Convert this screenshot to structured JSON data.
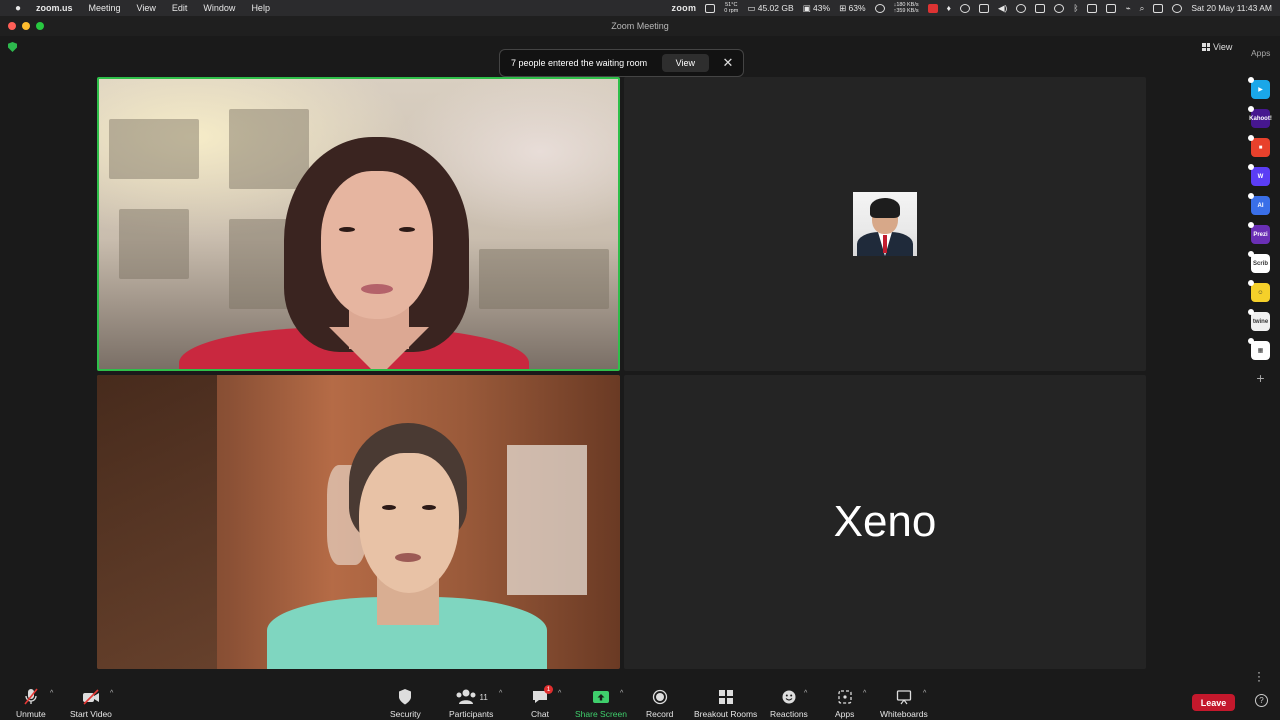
{
  "menubar": {
    "app_name": "zoom.us",
    "menus": [
      "Meeting",
      "View",
      "Edit",
      "Window",
      "Help"
    ],
    "zoom_brand": "zoom",
    "temp": "51°C",
    "fan": "0 rpm",
    "disk": "45.02 GB",
    "cpu": "43%",
    "mem": "63%",
    "net_down": "↓180 KB/s",
    "net_up": "↑359 KB/s",
    "datetime": "Sat 20 May  11:43 AM"
  },
  "window": {
    "title": "Zoom Meeting"
  },
  "notification": {
    "message": "7 people entered the waiting room",
    "view_label": "View",
    "close_glyph": "✕"
  },
  "view_menu": {
    "label": "View"
  },
  "apps_rail": {
    "label": "Apps",
    "apps": [
      {
        "name": "app-1",
        "color": "#1aa7e8",
        "glyph": "▶"
      },
      {
        "name": "app-kahoot",
        "color": "#46178f",
        "glyph": "Kahoot!"
      },
      {
        "name": "app-3",
        "color": "#e8412c",
        "glyph": "■"
      },
      {
        "name": "app-w",
        "color": "#5b3df5",
        "glyph": "W"
      },
      {
        "name": "app-ai",
        "color": "#3a6fe8",
        "glyph": "AI"
      },
      {
        "name": "app-prezi",
        "color": "#6a2fb5",
        "glyph": "Prezi"
      },
      {
        "name": "app-scribble",
        "color": "#ffffff",
        "glyph": "Scrib"
      },
      {
        "name": "app-emoji",
        "color": "#f5d02a",
        "glyph": "☺"
      },
      {
        "name": "app-twine",
        "color": "#f0f0f0",
        "glyph": "twine"
      },
      {
        "name": "app-grid",
        "color": "#ffffff",
        "glyph": "▦"
      }
    ],
    "add_glyph": "+"
  },
  "participants": {
    "tile4_name": "Xeno"
  },
  "toolbar": {
    "unmute": "Unmute",
    "start_video": "Start Video",
    "security": "Security",
    "participants": "Participants",
    "participant_count": "11",
    "chat": "Chat",
    "chat_badge": "1",
    "share_screen": "Share Screen",
    "record": "Record",
    "breakout_rooms": "Breakout Rooms",
    "reactions": "Reactions",
    "apps": "Apps",
    "whiteboards": "Whiteboards",
    "leave": "Leave",
    "help": "?"
  },
  "colors": {
    "active_speaker_border": "#2fbf4a",
    "share_green": "#3fcf6c",
    "leave_red": "#c4182c"
  }
}
